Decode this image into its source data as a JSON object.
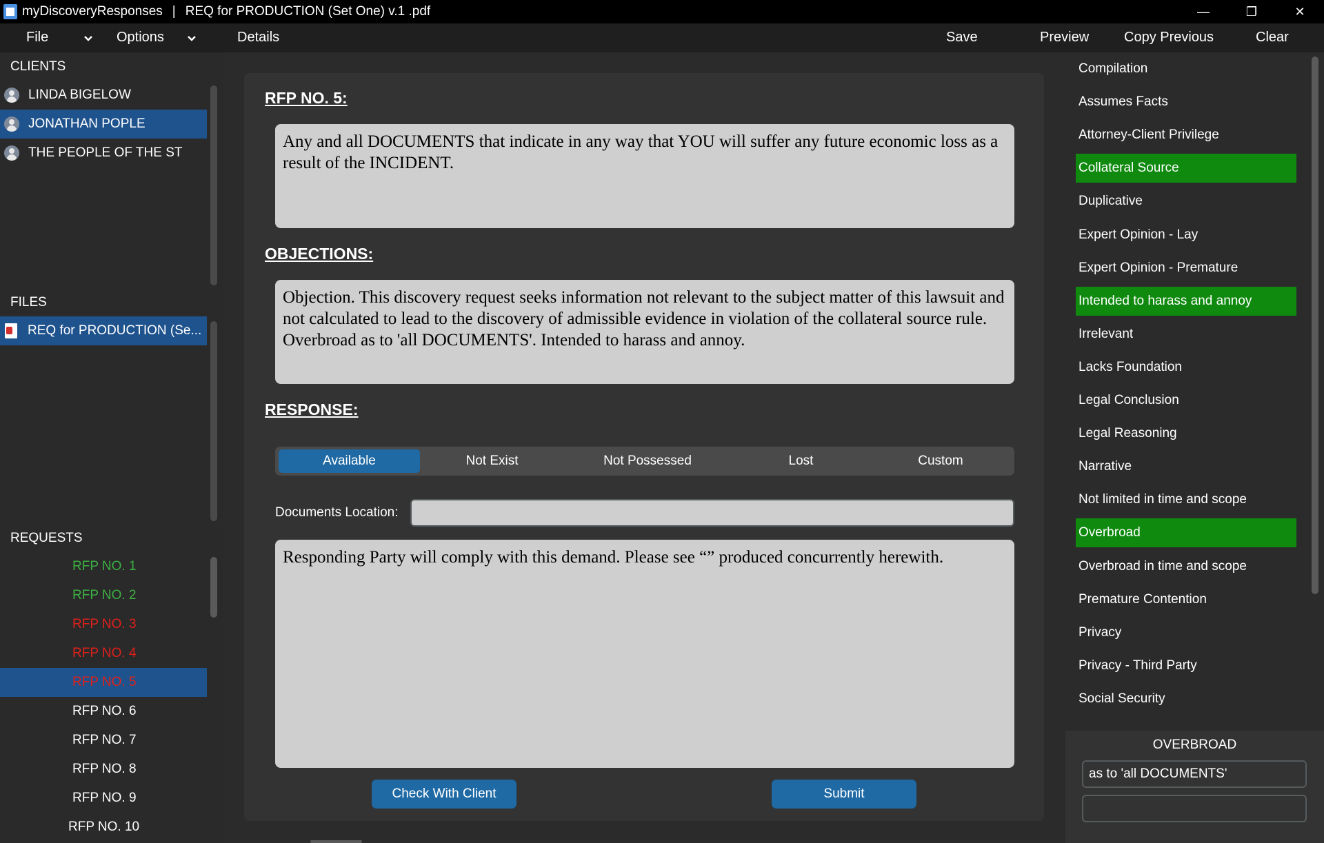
{
  "window": {
    "app_name": "myDiscoveryResponses",
    "separator": "|",
    "document_title": "REQ for PRODUCTION (Set One) v.1 .pdf",
    "minimize_glyph": "—",
    "maximize_glyph": "❐",
    "close_glyph": "✕"
  },
  "menu": {
    "file": "File",
    "options": "Options",
    "details": "Details",
    "save": "Save",
    "preview": "Preview",
    "copy_previous": "Copy Previous",
    "clear": "Clear"
  },
  "clients": {
    "title": "CLIENTS",
    "items": [
      "LINDA BIGELOW",
      "JONATHAN POPLE",
      "THE PEOPLE OF THE ST"
    ],
    "selected_index": 1
  },
  "files": {
    "title": "FILES",
    "items": [
      "REQ for PRODUCTION (Se..."
    ]
  },
  "requests": {
    "title": "REQUESTS",
    "items": [
      {
        "label": "RFP NO. 1",
        "status_color": "#3cb043"
      },
      {
        "label": "RFP NO. 2",
        "status_color": "#3cb043"
      },
      {
        "label": "RFP NO. 3",
        "status_color": "#e0201b"
      },
      {
        "label": "RFP NO. 4",
        "status_color": "#e0201b"
      },
      {
        "label": "RFP NO. 5",
        "status_color": "#e0201b"
      },
      {
        "label": "RFP NO. 6",
        "status_color": "#ffffff"
      },
      {
        "label": "RFP NO. 7",
        "status_color": "#ffffff"
      },
      {
        "label": "RFP NO. 8",
        "status_color": "#ffffff"
      },
      {
        "label": "RFP NO. 9",
        "status_color": "#ffffff"
      },
      {
        "label": "RFP NO. 10",
        "status_color": "#ffffff"
      }
    ],
    "selected_index": 4
  },
  "main": {
    "request_heading": "RFP NO. 5:",
    "request_text": "Any and all DOCUMENTS that indicate in any way that YOU will suffer any future economic loss as a result of the INCIDENT.",
    "objections_heading": "OBJECTIONS:",
    "objections_text": "Objection. This discovery request seeks information not relevant to the subject matter of this lawsuit and not calculated to lead to the discovery of admissible evidence in violation of the collateral source rule. Overbroad as to 'all DOCUMENTS'. Intended to harass and annoy.",
    "response_heading": "RESPONSE:",
    "response_options": [
      "Available",
      "Not Exist",
      "Not Possessed",
      "Lost",
      "Custom"
    ],
    "response_selected": "Available",
    "documents_location_label": "Documents Location:",
    "documents_location_value": "",
    "response_text": "Responding Party will comply with this demand. Please see “” produced concurrently herewith.",
    "check_with_client": "Check With Client",
    "submit": "Submit"
  },
  "objections_list": {
    "items": [
      {
        "label": "Compilation",
        "active": false
      },
      {
        "label": "Assumes Facts",
        "active": false
      },
      {
        "label": "Attorney-Client Privilege",
        "active": false
      },
      {
        "label": "Collateral Source",
        "active": true
      },
      {
        "label": "Duplicative",
        "active": false
      },
      {
        "label": "Expert Opinion - Lay",
        "active": false
      },
      {
        "label": "Expert Opinion - Premature",
        "active": false
      },
      {
        "label": "Intended to harass and annoy",
        "active": true
      },
      {
        "label": "Irrelevant",
        "active": false
      },
      {
        "label": "Lacks Foundation",
        "active": false
      },
      {
        "label": "Legal Conclusion",
        "active": false
      },
      {
        "label": "Legal Reasoning",
        "active": false
      },
      {
        "label": "Narrative",
        "active": false
      },
      {
        "label": "Not limited in time and scope",
        "active": false
      },
      {
        "label": "Overbroad",
        "active": true
      },
      {
        "label": "Overbroad in time and scope",
        "active": false
      },
      {
        "label": "Premature Contention",
        "active": false
      },
      {
        "label": "Privacy",
        "active": false
      },
      {
        "label": "Privacy - Third Party",
        "active": false
      },
      {
        "label": "Social Security",
        "active": false
      }
    ],
    "active_color": "#0f8a0f"
  },
  "detail_panel": {
    "title": "OVERBROAD",
    "input1_value": "as to 'all DOCUMENTS'",
    "input2_value": ""
  }
}
